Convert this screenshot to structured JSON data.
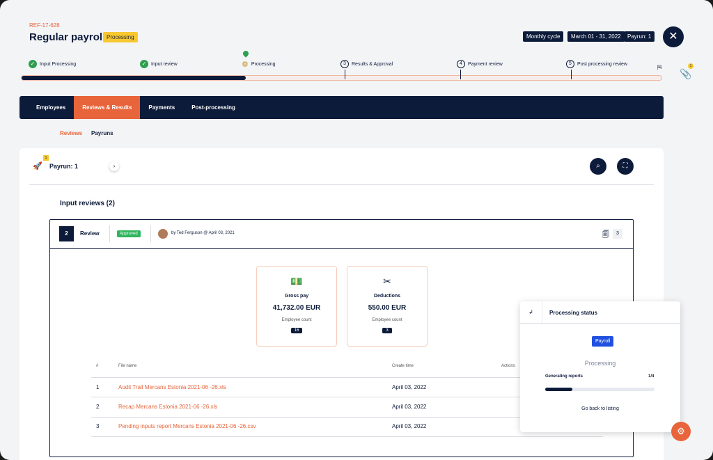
{
  "header": {
    "ref": "REF-17-628",
    "title": "Regular payroll",
    "status": "Processing",
    "chips": [
      "Monthly cycle",
      "March 01 - 31, 2022",
      "Payrun: 1"
    ],
    "close_icon": "close-icon",
    "attachments_badge": "1"
  },
  "steps": [
    {
      "label": "Input Processing",
      "state": "done"
    },
    {
      "label": "Input review",
      "state": "done"
    },
    {
      "label": "Processing",
      "state": "current"
    },
    {
      "num": "3",
      "label": "Results & Approval",
      "state": "todo"
    },
    {
      "num": "4",
      "label": "Payment review",
      "state": "todo"
    },
    {
      "num": "5",
      "label": "Post processing review",
      "state": "todo"
    }
  ],
  "progress": {
    "fraction": 0.35
  },
  "nav": {
    "tabs": [
      "Employees",
      "Reviews & Results",
      "Payments",
      "Post-processing"
    ],
    "active": "Reviews & Results"
  },
  "subnav": {
    "items": [
      "Reviews",
      "Payruns"
    ],
    "active": "Reviews"
  },
  "payrun": {
    "title": "Payrun: 1",
    "badge": "1"
  },
  "section": {
    "title": "Input reviews (2)"
  },
  "review": {
    "number": "2",
    "label": "Review",
    "status": "Approved",
    "byline": "by Ted Ferguson @ April 03, 2021",
    "doc_count": "3"
  },
  "stats": [
    {
      "label": "Gross pay",
      "value": "41,732.00 EUR",
      "sub": "Employee count",
      "count": "16",
      "icon": "money-icon"
    },
    {
      "label": "Deductions",
      "value": "550.00 EUR",
      "sub": "Employee count",
      "count": "3",
      "icon": "scissors-icon"
    }
  ],
  "files": {
    "headers": {
      "num": "#",
      "name": "File name",
      "time": "Create time",
      "actions": "Actions"
    },
    "rows": [
      {
        "num": "1",
        "name": "Audit Trail Mercans Estonia 2021-06 -26.xls",
        "time": "April 03, 2022"
      },
      {
        "num": "2",
        "name": "Recap Mercans Estonia 2021-06 -26.xls",
        "time": "April 03, 2022"
      },
      {
        "num": "3",
        "name": "Pending inputs report Mercans Estonia 2021-06 -26.csv",
        "time": "April 03, 2022"
      }
    ]
  },
  "processing_status": {
    "title": "Processing status",
    "chip": "Payroll",
    "state": "Processing",
    "task": "Generating reports",
    "fraction_text": "1/4",
    "fraction": 0.25,
    "back": "Go back to listing"
  },
  "colors": {
    "navy": "#0d1b3a",
    "accent": "#e8643a",
    "yellow": "#f7c830",
    "green": "#2eb55d",
    "blue": "#2050e0"
  }
}
